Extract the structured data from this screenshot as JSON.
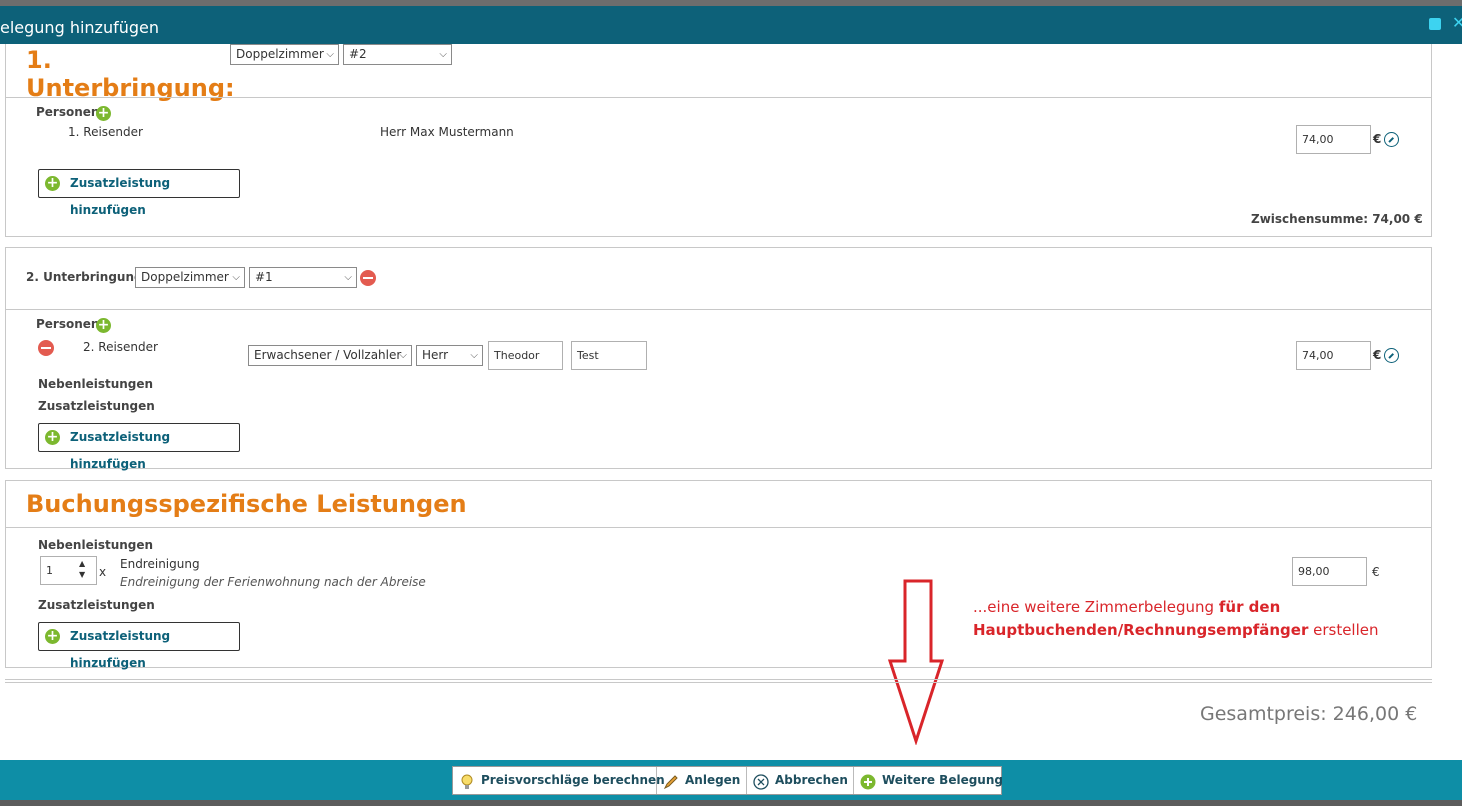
{
  "window": {
    "title": "elegung hinzufügen",
    "close_glyph": "✕"
  },
  "room1": {
    "title_line1": "1.",
    "title_line2": "Unterbringung:",
    "room_type": "Doppelzimmer",
    "room_number": "#2",
    "persons_label": "Personen",
    "traveler_label": "1. Reisender",
    "traveler_name": "Herr Max Mustermann",
    "price": "74,00",
    "currency": "€",
    "add_extra_label": "Zusatzleistung hinzufügen",
    "subtotal": "Zwischensumme: 74,00 €"
  },
  "room2": {
    "title": "2. Unterbringung:",
    "room_type": "Doppelzimmer",
    "room_number": "#1",
    "persons_label": "Personen",
    "traveler_label": "2. Reisender",
    "guest_type": "Erwachsener / Vollzahler",
    "salutation": "Herr",
    "first_name": "Theodor",
    "last_name": "Test",
    "price": "74,00",
    "currency": "€",
    "side_services_label": "Nebenleistungen",
    "extra_services_label": "Zusatzleistungen",
    "add_extra_label": "Zusatzleistung hinzufügen"
  },
  "booking_services": {
    "title": "Buchungsspezifische Leistungen",
    "side_services_label": "Nebenleistungen",
    "quantity": "1",
    "times": "x",
    "service_name": "Endreinigung",
    "service_desc": "Endreinigung der Ferienwohnung nach der Abreise",
    "price": "98,00",
    "currency": "€",
    "extra_services_label": "Zusatzleistungen",
    "add_extra_label": "Zusatzleistung hinzufügen"
  },
  "annotation": {
    "text_prefix": "...eine weitere Zimmerbelegung ",
    "text_bold1": "für den",
    "text_bold2": "Hauptbuchenden/Rechnungsempfänger",
    "text_suffix": " erstellen",
    "color": "#d9252a"
  },
  "total": "Gesamtpreis: 246,00 €",
  "toolbar": {
    "price_suggestions": "Preisvorschläge berechnen",
    "create": "Anlegen",
    "cancel": "Abbrechen",
    "more_booking": "Weitere Belegung"
  },
  "colors": {
    "header": "#0d6179",
    "accent": "#e47d16",
    "footer": "#0e8ea6"
  }
}
